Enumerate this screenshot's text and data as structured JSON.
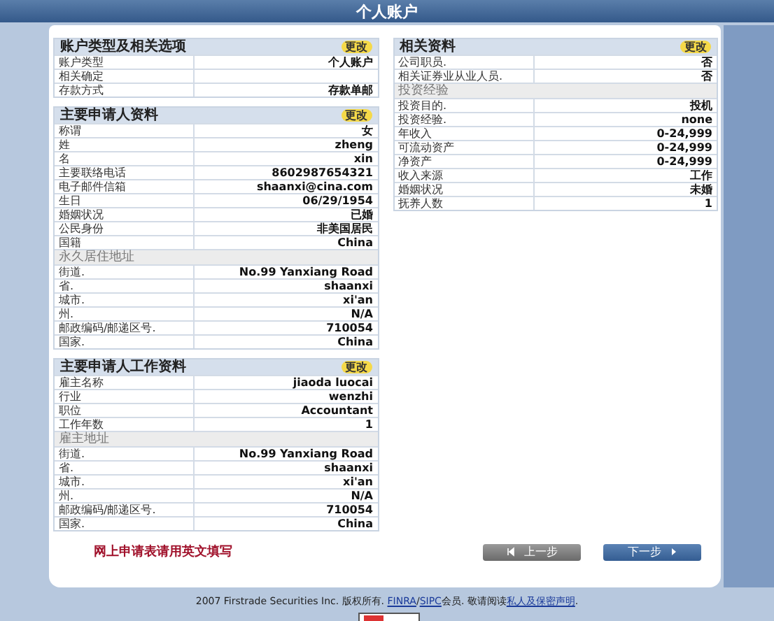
{
  "title": "个人账户",
  "left_sections": [
    {
      "title": "账户类型及相关选项",
      "action": "更改",
      "rows": [
        {
          "kind": "row",
          "label": "账户类型",
          "value": "个人账户"
        },
        {
          "kind": "row",
          "label": "相关确定"
        },
        {
          "kind": "row",
          "label": "存款方式",
          "value": "存款单邮"
        }
      ]
    },
    {
      "title": "主要申请人资料",
      "action": "更改",
      "rows": [
        {
          "kind": "row",
          "label": "称谓",
          "value": "女"
        },
        {
          "kind": "row",
          "label": "姓",
          "value": "zheng"
        },
        {
          "kind": "row",
          "label": "名",
          "value": "xin"
        },
        {
          "kind": "row",
          "label": "主要联络电话",
          "value": "8602987654321"
        },
        {
          "kind": "row",
          "label": "电子邮件信箱",
          "value": "shaanxi@cina.com"
        },
        {
          "kind": "row",
          "label": "生日",
          "value": "06/29/1954"
        },
        {
          "kind": "row",
          "label": "婚姻状况",
          "value": "已婚"
        },
        {
          "kind": "row",
          "label": "公民身份",
          "value": "非美国居民"
        },
        {
          "kind": "row",
          "label": "国籍",
          "value": "China"
        },
        {
          "kind": "subheader",
          "label": "永久居住地址"
        },
        {
          "kind": "row",
          "label": "街道.",
          "value": "No.99 Yanxiang Road"
        },
        {
          "kind": "row",
          "label": "省.",
          "value": "shaanxi"
        },
        {
          "kind": "row",
          "label": "城市.",
          "value": "xi'an"
        },
        {
          "kind": "row",
          "label": "州.",
          "value": "N/A"
        },
        {
          "kind": "row",
          "label": "邮政编码/邮递区号.",
          "value": "710054"
        },
        {
          "kind": "row",
          "label": "国家.",
          "value": "China"
        }
      ]
    },
    {
      "title": "主要申请人工作资料",
      "action": "更改",
      "rows": [
        {
          "kind": "row",
          "label": "雇主名称",
          "value": "jiaoda luocai"
        },
        {
          "kind": "row",
          "label": "行业",
          "value": "wenzhi"
        },
        {
          "kind": "row",
          "label": "职位",
          "value": "Accountant"
        },
        {
          "kind": "row",
          "label": "工作年数",
          "value": "1"
        },
        {
          "kind": "subheader",
          "label": "雇主地址"
        },
        {
          "kind": "row",
          "label": "街道.",
          "value": "No.99 Yanxiang Road"
        },
        {
          "kind": "row",
          "label": "省.",
          "value": "shaanxi"
        },
        {
          "kind": "row",
          "label": "城市.",
          "value": "xi'an"
        },
        {
          "kind": "row",
          "label": "州.",
          "value": "N/A"
        },
        {
          "kind": "row",
          "label": "邮政编码/邮递区号.",
          "value": "710054"
        },
        {
          "kind": "row",
          "label": "国家.",
          "value": "China"
        }
      ]
    }
  ],
  "right_sections": [
    {
      "title": "相关资料",
      "action": "更改",
      "rows": [
        {
          "kind": "row",
          "label": "公司职员.",
          "value": "否"
        },
        {
          "kind": "row",
          "label": "相关证券业从业人员.",
          "value": "否"
        },
        {
          "kind": "subheader",
          "label": "投资经验"
        },
        {
          "kind": "row",
          "label": "投资目的.",
          "value": "投机"
        },
        {
          "kind": "row",
          "label": "投资经验.",
          "value": "none"
        },
        {
          "kind": "row",
          "label": "年收入",
          "value": "0-24,999"
        },
        {
          "kind": "row",
          "label": "可流动资产",
          "value": "0-24,999"
        },
        {
          "kind": "row",
          "label": "净资产",
          "value": "0-24,999"
        },
        {
          "kind": "row",
          "label": "收入来源",
          "value": "工作"
        },
        {
          "kind": "row",
          "label": "婚姻状况",
          "value": "未婚"
        },
        {
          "kind": "row",
          "label": "抚养人数",
          "value": "1"
        }
      ]
    }
  ],
  "note": "网上申请表请用英文填写",
  "buttons": [
    {
      "kind": "back",
      "label": "上一步"
    },
    {
      "kind": "next",
      "label": "下一步"
    }
  ],
  "footer": [
    {
      "text": "2007 Firstrade Securities Inc. 版权所有. ",
      "link": false
    },
    {
      "text": "FINRA",
      "link": true
    },
    {
      "text": "/",
      "link": false
    },
    {
      "text": "SIPC",
      "link": true
    },
    {
      "text": "会员. 敬请阅读",
      "link": false
    },
    {
      "text": "私人及保密声明",
      "link": true
    },
    {
      "text": ".",
      "link": false
    }
  ]
}
